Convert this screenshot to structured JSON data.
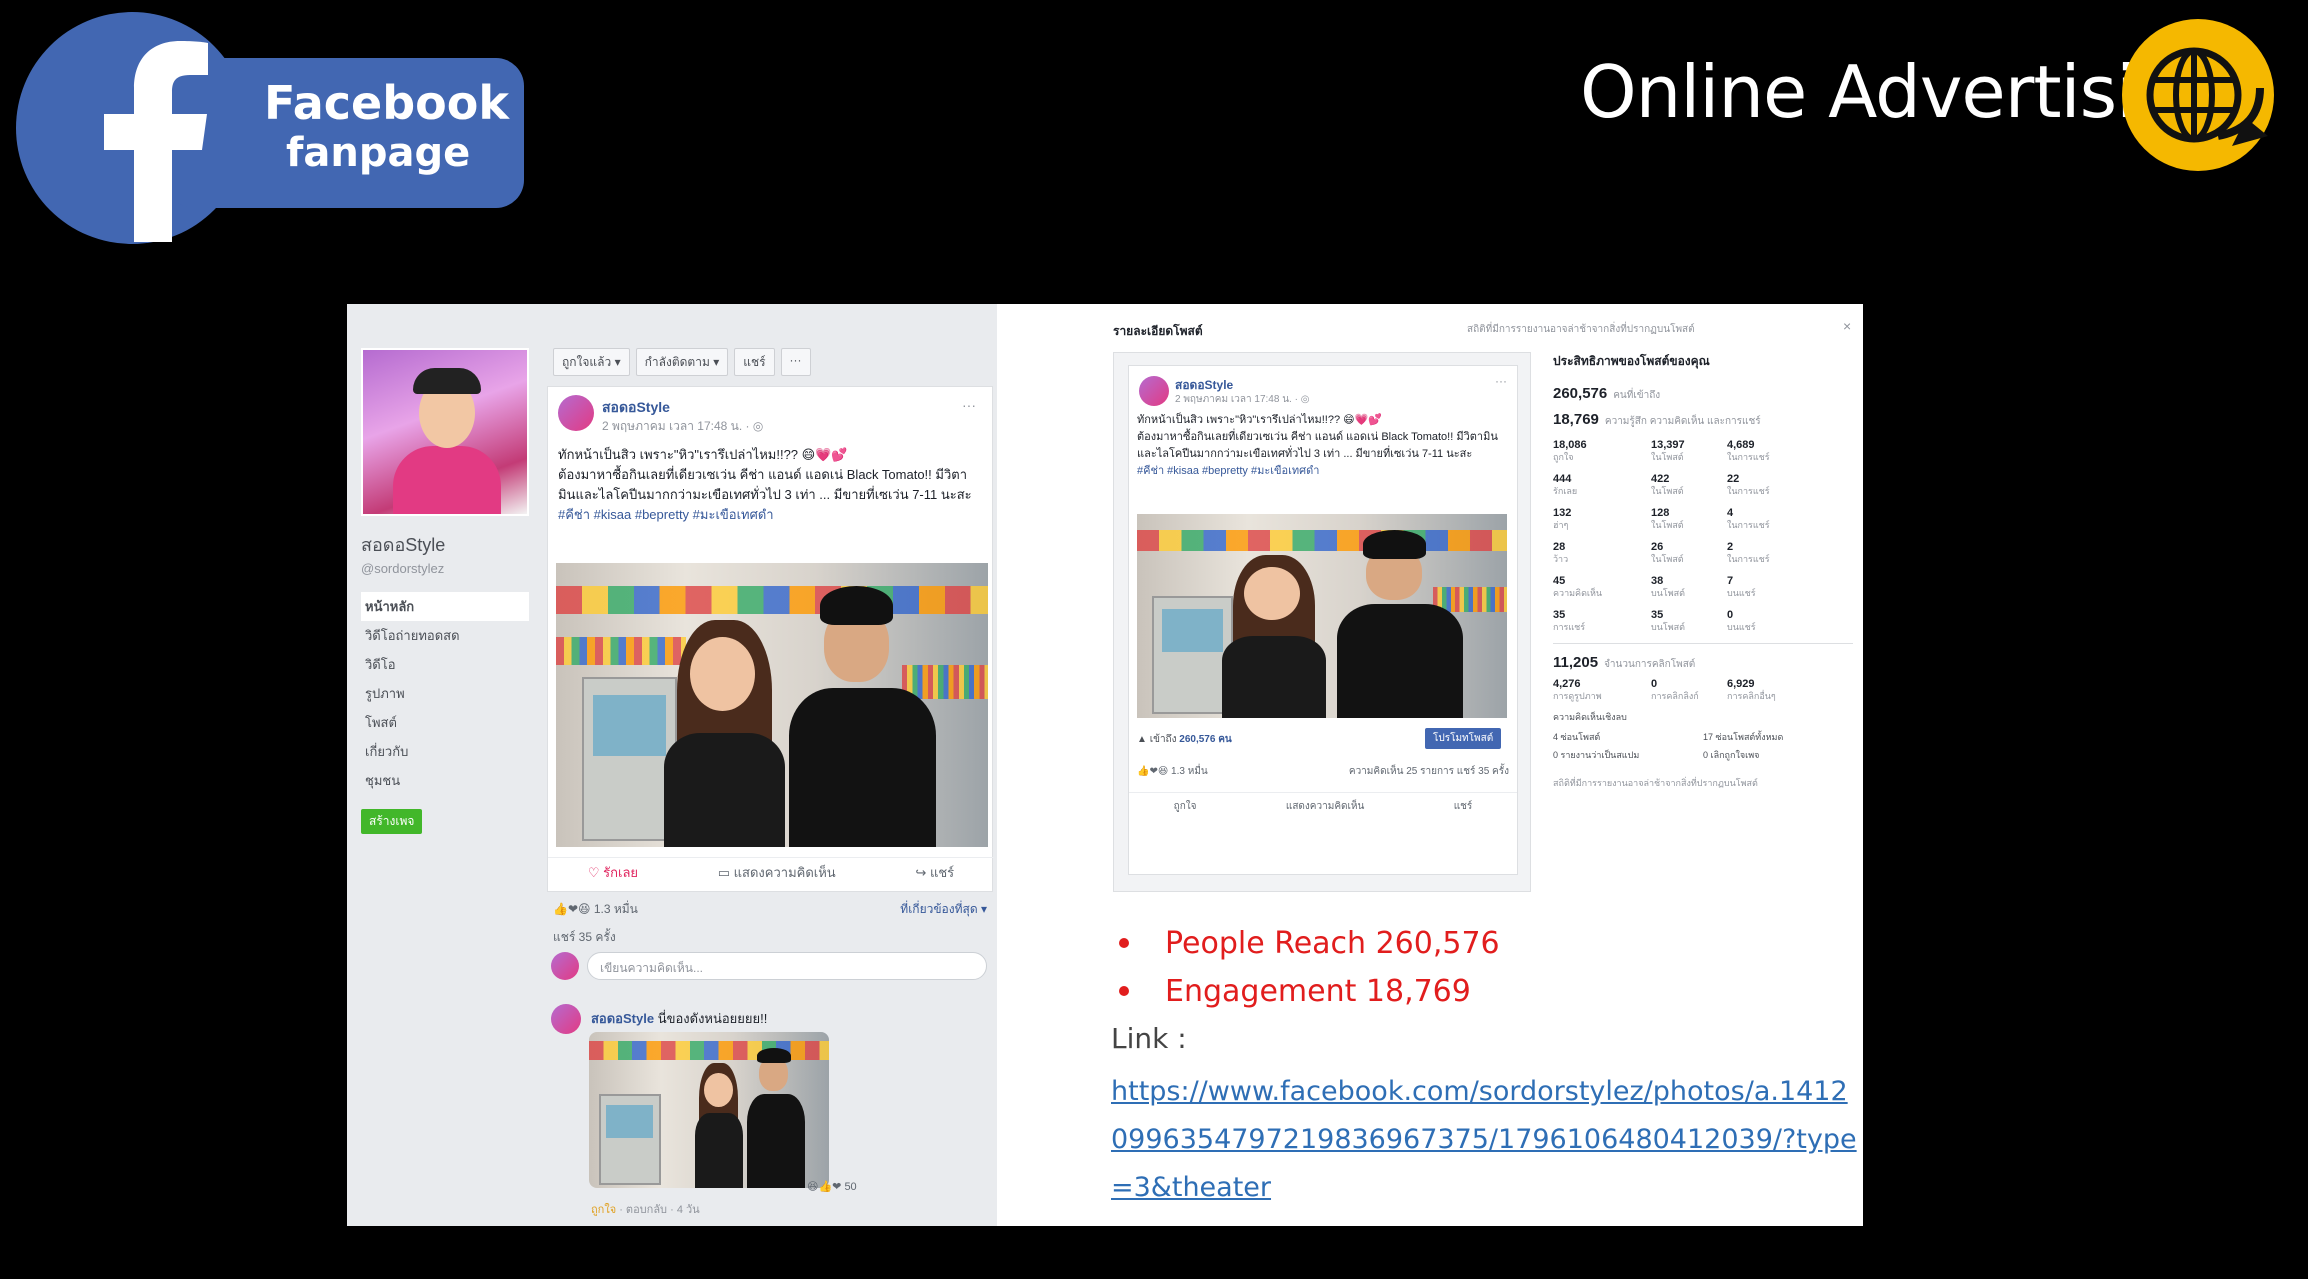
{
  "header": {
    "fb_line1": "Facebook",
    "fb_line2": "fanpage",
    "title": "Online Advertising",
    "fb_color": "#4267b2",
    "accent_color": "#f5b800"
  },
  "page": {
    "name": "สอดอStyle",
    "handle": "@sordorstylez",
    "nav": [
      "หน้าหลัก",
      "วิดีโอถ่ายทอดสด",
      "วิดีโอ",
      "รูปภาพ",
      "โพสต์",
      "เกี่ยวกับ",
      "ชุมชน"
    ],
    "create_page": "สร้างเพจ",
    "actions": [
      "ถูกใจแล้ว ▾",
      "กำลังติดตาม ▾",
      "แชร์",
      "···"
    ]
  },
  "post": {
    "author": "สอดอStyle",
    "time": "2 พฤษภาคม เวลา 17:48 น. · ◎",
    "line1": "ทักหน้าเป็นสิว เพราะ\"หิว\"เรารึเปล่าไหม!!?? 😄💗💕",
    "line2": "ต้องมาหาซื้อกินเลยที่เดียวเซเว่น คีช่า แอนด์ แอดเน่ Black Tomato!! มีวิตามินและไลโคปีนมากกว่ามะเขือเทศทั่วไป 3 เท่า ... มีขายที่เซเว่น 7-11 นะสะ",
    "tags": "#คีช่า #kisaa #bepretty #มะเขือเทศดำ",
    "actions": [
      "รักเลย",
      "แสดงความคิดเห็น",
      "แชร์"
    ],
    "reactions": "1.3 หมื่น",
    "most_relevant": "ที่เกี่ยวข้องที่สุด ▾",
    "shares": "แชร์ 35 ครั้ง",
    "comment_placeholder": "เขียนความคิดเห็น...",
    "reply_author": "สอดอStyle",
    "reply_text": "นี่ของดังหน่อยยยย!!",
    "reply_reacts": "50",
    "reply_meta_like": "ถูกใจ",
    "reply_meta_rest": "· ตอบกลับ · 4 วัน"
  },
  "insight": {
    "title": "รายละเอียดโพสต์",
    "subtitle": "สถิติที่มีการรายงานอาจล่าช้าจากสิ่งที่ปรากฏบนโพสต์",
    "close": "×",
    "reach_label": "เข้าถึง",
    "reach_value": "260,576 คน",
    "boost": "โปรโมทโพสต์",
    "mini_reacts": "1.3 หมื่น",
    "mini_counts": "ความคิดเห็น 25 รายการ แชร์ 35 ครั้ง",
    "mini_actions": [
      "ถูกใจ",
      "แสดงความคิดเห็น",
      "แชร์"
    ],
    "perf_title": "ประสิทธิภาพของโพสต์ของคุณ",
    "reach": "260,576",
    "reach_unit": "คนที่เข้าถึง",
    "engagement": "18,769",
    "engagement_unit": "ความรู้สึก ความคิดเห็น และการแชร์",
    "grid": [
      {
        "v": "18,086",
        "l": "ถูกใจ"
      },
      {
        "v": "13,397",
        "l": "ในโพสต์"
      },
      {
        "v": "4,689",
        "l": "ในการแชร์"
      },
      {
        "v": "444",
        "l": "รักเลย"
      },
      {
        "v": "422",
        "l": "ในโพสต์"
      },
      {
        "v": "22",
        "l": "ในการแชร์"
      },
      {
        "v": "132",
        "l": "ฮ่าๆ"
      },
      {
        "v": "128",
        "l": "ในโพสต์"
      },
      {
        "v": "4",
        "l": "ในการแชร์"
      },
      {
        "v": "28",
        "l": "ว้าว"
      },
      {
        "v": "26",
        "l": "ในโพสต์"
      },
      {
        "v": "2",
        "l": "ในการแชร์"
      },
      {
        "v": "45",
        "l": "ความคิดเห็น"
      },
      {
        "v": "38",
        "l": "บนโพสต์"
      },
      {
        "v": "7",
        "l": "บนแชร์"
      },
      {
        "v": "35",
        "l": "การแชร์"
      },
      {
        "v": "35",
        "l": "บนโพสต์"
      },
      {
        "v": "0",
        "l": "บนแชร์"
      }
    ],
    "clicks": "11,205",
    "clicks_unit": "จำนวนการคลิกโพสต์",
    "click_grid": [
      {
        "v": "4,276",
        "l": "การดูรูปภาพ"
      },
      {
        "v": "0",
        "l": "การคลิกลิงก์"
      },
      {
        "v": "6,929",
        "l": "การคลิกอื่นๆ"
      }
    ],
    "neg_title": "ความคิดเห็นเชิงลบ",
    "neg": [
      "4 ซ่อนโพสต์",
      "17 ซ่อนโพสต์ทั้งหมด",
      "0 รายงานว่าเป็นสแปม",
      "0 เลิกถูกใจเพจ"
    ],
    "foot": "สถิติที่มีการรายงานอาจล่าช้าจากสิ่งที่ปรากฏบนโพสต์"
  },
  "summary": {
    "reach": "People Reach 260,576",
    "engagement": "Engagement 18,769",
    "link_label": "Link :",
    "link_url": "https://www.facebook.com/sordorstylez/photos/a.14120996354797219836967375/1796106480412039/?type=3&theater",
    "highlight_color": "#e11d1d",
    "link_color": "#2e6eb5"
  }
}
